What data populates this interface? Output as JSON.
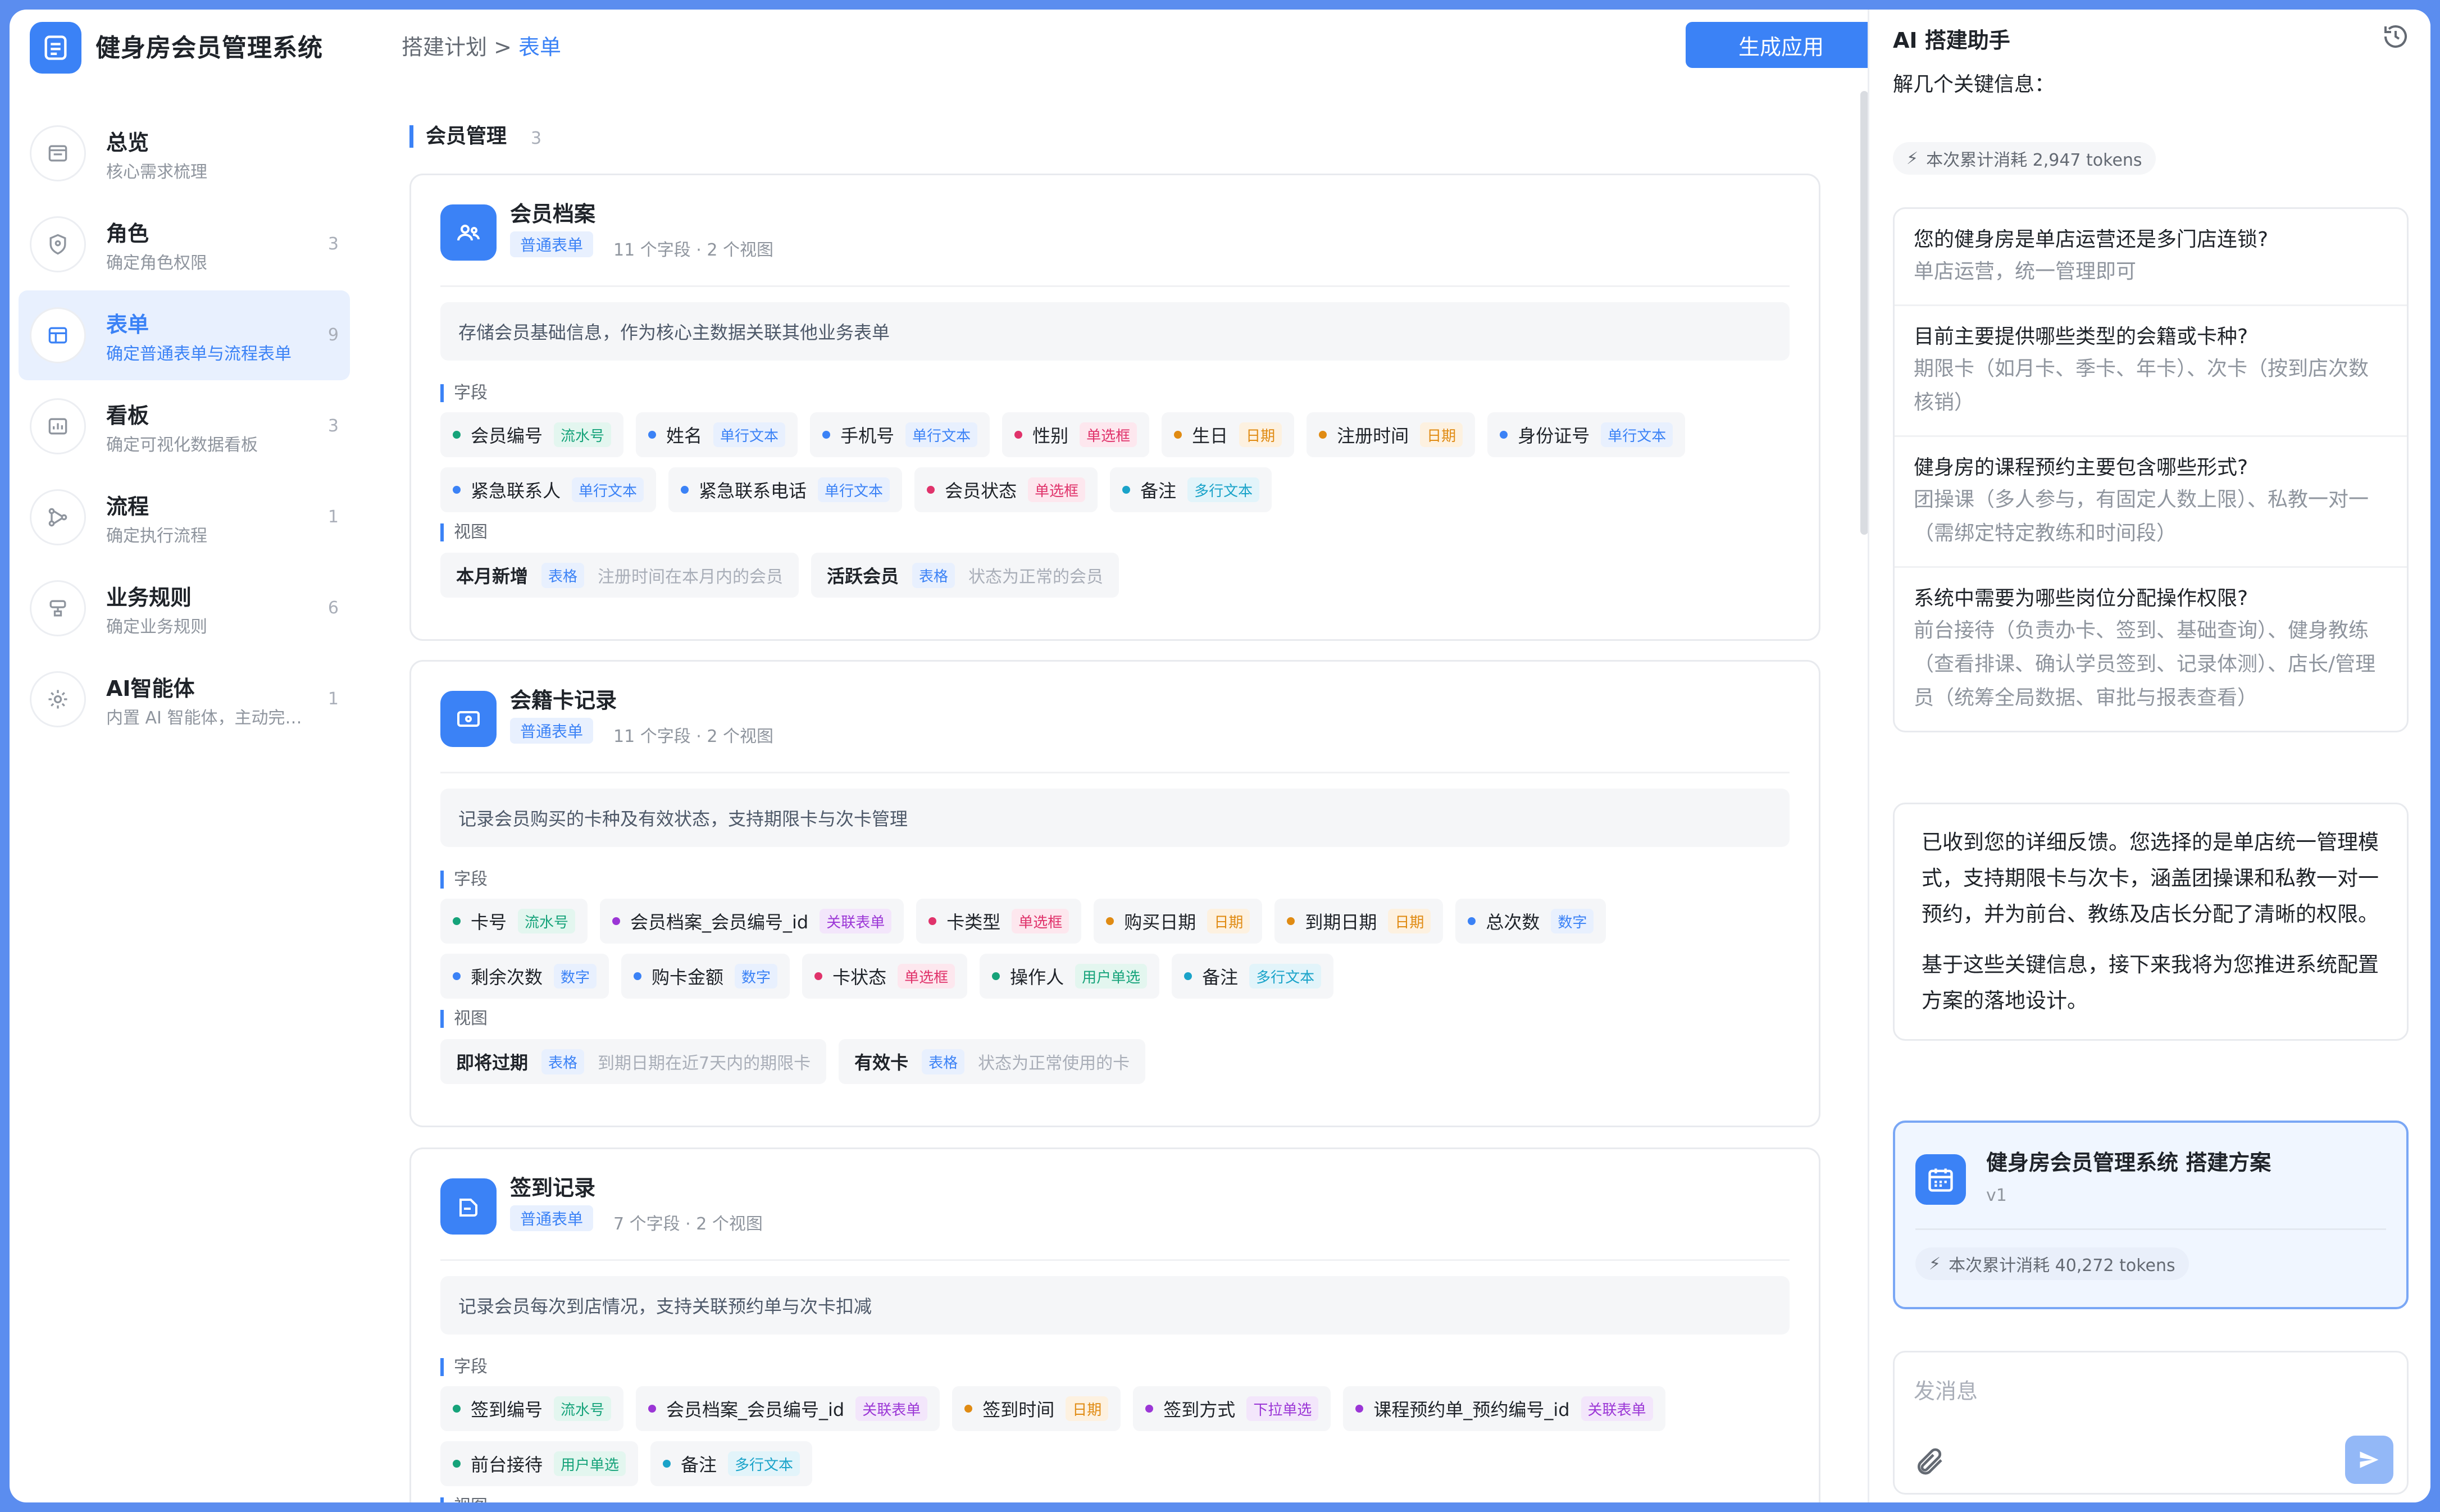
{
  "app": {
    "title": "健身房会员管理系统"
  },
  "breadcrumb": {
    "parent": "搭建计划",
    "sep": ">",
    "current": "表单"
  },
  "header": {
    "generate_label": "生成应用"
  },
  "colors": {
    "accent": "#3b82f6",
    "green": "#16a37a",
    "blue": "#3b82f6",
    "pink": "#e0336b",
    "orange": "#e08b13",
    "purple": "#9b36d6",
    "cyan": "#1aa3c9"
  },
  "sidebar": {
    "items": [
      {
        "title": "总览",
        "sub": "核心需求梳理",
        "count": "",
        "icon": "overview-icon"
      },
      {
        "title": "角色",
        "sub": "确定角色权限",
        "count": "3",
        "icon": "shield-icon"
      },
      {
        "title": "表单",
        "sub": "确定普通表单与流程表单",
        "count": "9",
        "icon": "table-icon"
      },
      {
        "title": "看板",
        "sub": "确定可视化数据看板",
        "count": "3",
        "icon": "dashboard-icon"
      },
      {
        "title": "流程",
        "sub": "确定执行流程",
        "count": "1",
        "icon": "flow-icon"
      },
      {
        "title": "业务规则",
        "sub": "确定业务规则",
        "count": "6",
        "icon": "rule-icon"
      },
      {
        "title": "AI智能体",
        "sub": "内置 AI 智能体，主动完成任务",
        "count": "1",
        "icon": "gear-icon"
      }
    ]
  },
  "section": {
    "title": "会员管理",
    "count": "3"
  },
  "labels": {
    "fields": "字段",
    "views": "视图"
  },
  "cards": [
    {
      "title": "会员档案",
      "tag": "普通表单",
      "meta": "11 个字段 · 2 个视图",
      "desc": "存储会员基础信息，作为核心主数据关联其他业务表单",
      "fields_rows": [
        [
          {
            "name": "会员编号",
            "type": "流水号",
            "c": "green"
          },
          {
            "name": "姓名",
            "type": "单行文本",
            "c": "blue"
          },
          {
            "name": "手机号",
            "type": "单行文本",
            "c": "blue"
          },
          {
            "name": "性别",
            "type": "单选框",
            "c": "pink"
          },
          {
            "name": "生日",
            "type": "日期",
            "c": "orange"
          },
          {
            "name": "注册时间",
            "type": "日期",
            "c": "orange"
          },
          {
            "name": "身份证号",
            "type": "单行文本",
            "c": "blue"
          }
        ],
        [
          {
            "name": "紧急联系人",
            "type": "单行文本",
            "c": "blue"
          },
          {
            "name": "紧急联系电话",
            "type": "单行文本",
            "c": "blue"
          },
          {
            "name": "会员状态",
            "type": "单选框",
            "c": "pink"
          },
          {
            "name": "备注",
            "type": "多行文本",
            "c": "cyan"
          }
        ]
      ],
      "views": [
        {
          "name": "本月新增",
          "type": "表格",
          "desc": "注册时间在本月内的会员"
        },
        {
          "name": "活跃会员",
          "type": "表格",
          "desc": "状态为正常的会员"
        }
      ]
    },
    {
      "title": "会籍卡记录",
      "tag": "普通表单",
      "meta": "11 个字段 · 2 个视图",
      "desc": "记录会员购买的卡种及有效状态，支持期限卡与次卡管理",
      "fields_rows": [
        [
          {
            "name": "卡号",
            "type": "流水号",
            "c": "green"
          },
          {
            "name": "会员档案_会员编号_id",
            "type": "关联表单",
            "c": "purple"
          },
          {
            "name": "卡类型",
            "type": "单选框",
            "c": "pink"
          },
          {
            "name": "购买日期",
            "type": "日期",
            "c": "orange"
          },
          {
            "name": "到期日期",
            "type": "日期",
            "c": "orange"
          },
          {
            "name": "总次数",
            "type": "数字",
            "c": "blue"
          }
        ],
        [
          {
            "name": "剩余次数",
            "type": "数字",
            "c": "blue"
          },
          {
            "name": "购卡金额",
            "type": "数字",
            "c": "blue"
          },
          {
            "name": "卡状态",
            "type": "单选框",
            "c": "pink"
          },
          {
            "name": "操作人",
            "type": "用户单选",
            "c": "green"
          },
          {
            "name": "备注",
            "type": "多行文本",
            "c": "cyan"
          }
        ]
      ],
      "views": [
        {
          "name": "即将过期",
          "type": "表格",
          "desc": "到期日期在近7天内的期限卡"
        },
        {
          "name": "有效卡",
          "type": "表格",
          "desc": "状态为正常使用的卡"
        }
      ]
    },
    {
      "title": "签到记录",
      "tag": "普通表单",
      "meta": "7 个字段 · 2 个视图",
      "desc": "记录会员每次到店情况，支持关联预约单与次卡扣减",
      "fields_rows": [
        [
          {
            "name": "签到编号",
            "type": "流水号",
            "c": "green"
          },
          {
            "name": "会员档案_会员编号_id",
            "type": "关联表单",
            "c": "purple"
          },
          {
            "name": "签到时间",
            "type": "日期",
            "c": "orange"
          },
          {
            "name": "签到方式",
            "type": "下拉单选",
            "c": "purple"
          },
          {
            "name": "课程预约单_预约编号_id",
            "type": "关联表单",
            "c": "purple"
          }
        ],
        [
          {
            "name": "前台接待",
            "type": "用户单选",
            "c": "green"
          },
          {
            "name": "备注",
            "type": "多行文本",
            "c": "cyan"
          }
        ]
      ],
      "views": []
    }
  ],
  "assistant": {
    "title": "AI 搭建助手",
    "intro": "解几个关键信息：",
    "token1": "本次累计消耗 2,947 tokens",
    "qa": [
      {
        "q": "您的健身房是单店运营还是多门店连锁?",
        "a": "单店运营，统一管理即可"
      },
      {
        "q": "目前主要提供哪些类型的会籍或卡种?",
        "a": "期限卡（如月卡、季卡、年卡）、次卡（按到店次数核销）"
      },
      {
        "q": "健身房的课程预约主要包含哪些形式?",
        "a": "团操课（多人参与，有固定人数上限）、私教一对一（需绑定特定教练和时间段）"
      },
      {
        "q": "系统中需要为哪些岗位分配操作权限?",
        "a": "前台接待（负责办卡、签到、基础查询）、健身教练（查看排课、确认学员签到、记录体测）、店长/管理员（统筹全局数据、审批与报表查看）"
      }
    ],
    "reply_p1": "已收到您的详细反馈。您选择的是单店统一管理模式，支持期限卡与次卡，涵盖团操课和私教一对一预约，并为前台、教练及店长分配了清晰的权限。",
    "reply_p2": "基于这些关键信息，接下来我将为您推进系统配置方案的落地设计。",
    "plan_title": "健身房会员管理系统  搭建方案",
    "plan_version": "v1",
    "token2": "本次累计消耗 40,272 tokens",
    "input_placeholder": "发消息"
  }
}
